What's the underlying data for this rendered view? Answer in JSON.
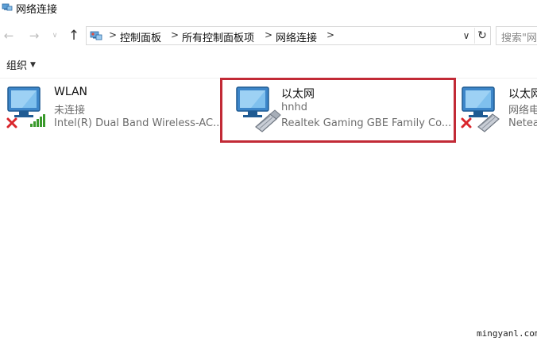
{
  "window": {
    "title": "网络连接"
  },
  "nav": {
    "back_icon": "back-arrow-icon",
    "forward_icon": "forward-arrow-icon",
    "up_icon": "up-arrow-icon"
  },
  "address": {
    "breadcrumbs": [
      "控制面板",
      "所有控制面板项",
      "网络连接"
    ],
    "separator": ">",
    "dropdown_glyph": "∨",
    "refresh_glyph": "↻"
  },
  "search": {
    "placeholder": "搜索\"网"
  },
  "toolbar": {
    "organize_label": "组织",
    "organize_caret": "▼"
  },
  "connections": [
    {
      "name": "WLAN",
      "status": "未连接",
      "device": "Intel(R) Dual Band Wireless-AC...",
      "icon": "wireless-adapter-icon",
      "disconnected": true
    },
    {
      "name": "以太网",
      "status": "hnhd",
      "device": "Realtek Gaming GBE Family Co...",
      "icon": "ethernet-adapter-icon",
      "disconnected": false
    },
    {
      "name": "以太网",
      "status": "网络电",
      "device": "Netea",
      "icon": "ethernet-adapter-icon",
      "disconnected": true
    }
  ],
  "colors": {
    "highlight": "#c22a36",
    "error_x": "#d9262c",
    "signal": "#3a9a2c"
  },
  "watermark": "mingyanl.com"
}
